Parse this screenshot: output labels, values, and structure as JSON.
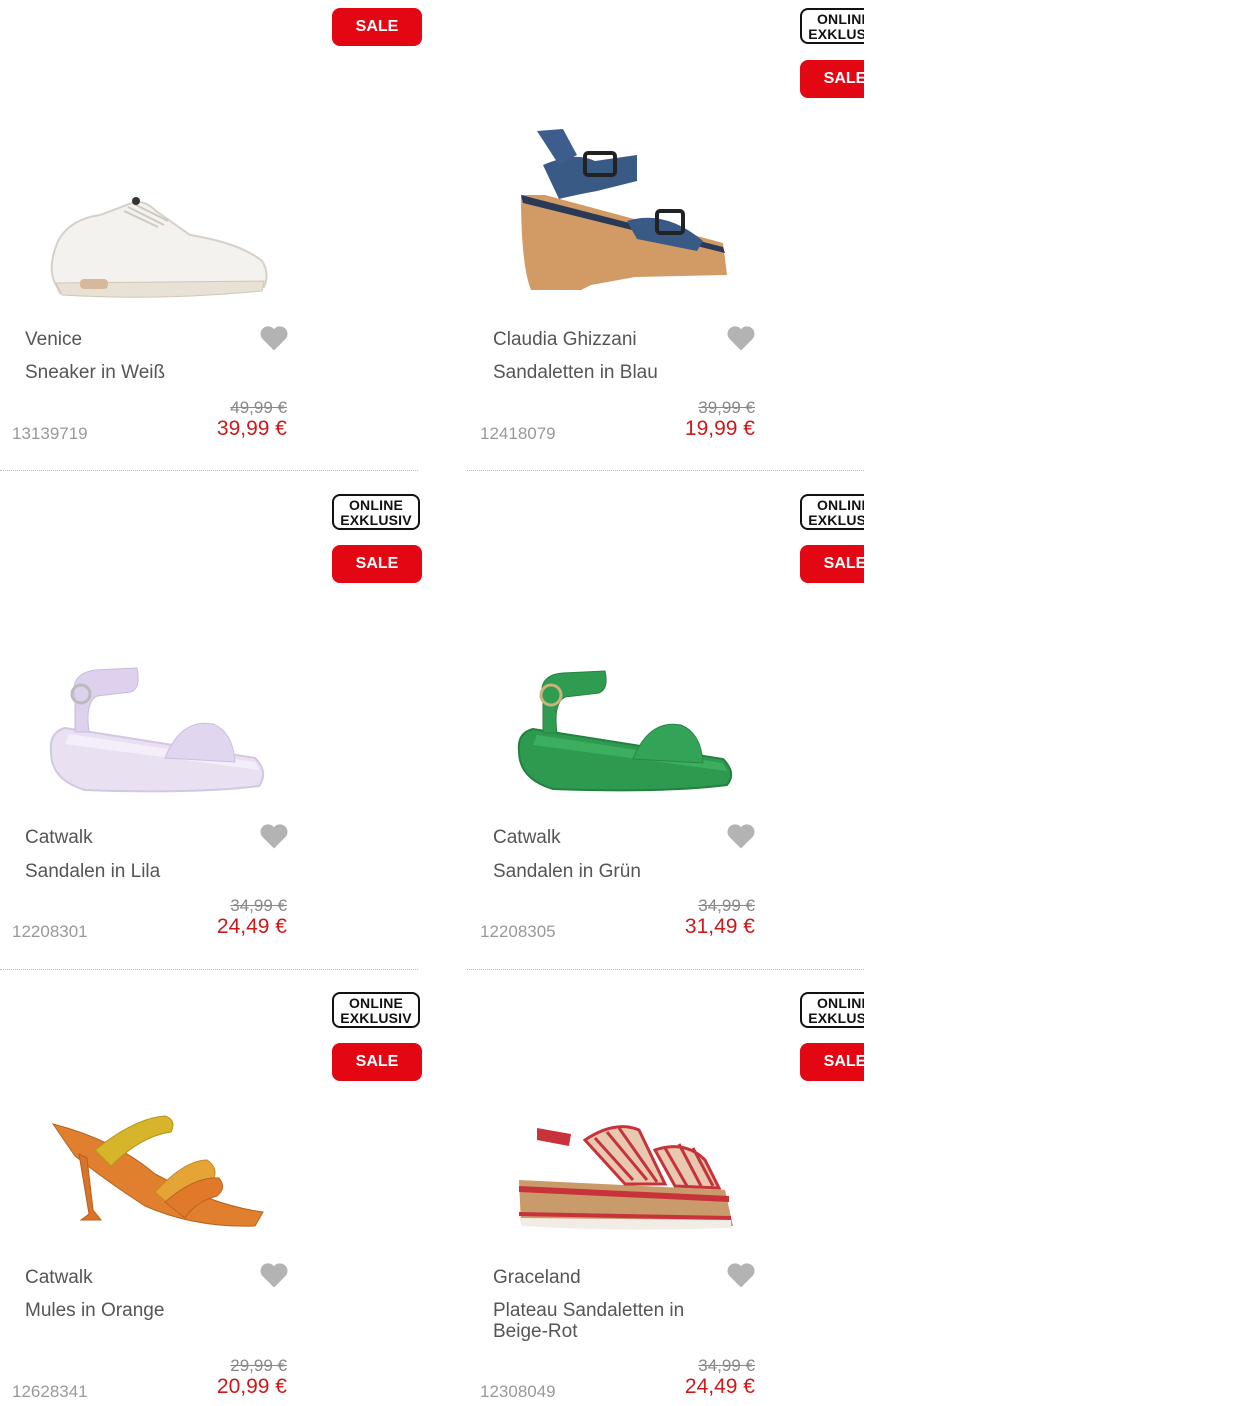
{
  "products": [
    {
      "brand": "Venice",
      "name": "Sneaker in Weiß",
      "sku": "13139719",
      "old_price": "49,99 €",
      "price": "39,99 €",
      "online_badge": "",
      "sale_badge": "SALE",
      "image": "white-sneaker"
    },
    {
      "brand": "Claudia Ghizzani",
      "name": "Sandaletten in Blau",
      "sku": "12418079",
      "old_price": "39,99 €",
      "price": "19,99 €",
      "online_badge": "ONLINE EXKLUSIV",
      "sale_badge": "SALE",
      "image": "blue-denim-platform-sandal"
    },
    {
      "brand": "Catwalk",
      "name": "Sandalen in Lila",
      "sku": "12208301",
      "old_price": "34,99 €",
      "price": "24,49 €",
      "online_badge": "ONLINE EXKLUSIV",
      "sale_badge": "SALE",
      "image": "lilac-sandal"
    },
    {
      "brand": "Catwalk",
      "name": "Sandalen in Grün",
      "sku": "12208305",
      "old_price": "34,99 €",
      "price": "31,49 €",
      "online_badge": "ONLINE EXKLUSIV",
      "sale_badge": "SALE",
      "image": "green-sandal"
    },
    {
      "brand": "Catwalk",
      "name": "Mules in Orange",
      "sku": "12628341",
      "old_price": "29,99 €",
      "price": "20,99 €",
      "online_badge": "ONLINE EXKLUSIV",
      "sale_badge": "SALE",
      "image": "orange-gold-mule"
    },
    {
      "brand": "Graceland",
      "name": "Plateau Sandaletten in Beige-Rot",
      "sku": "12308049",
      "old_price": "34,99 €",
      "price": "24,49 €",
      "online_badge": "ONLINE EXKLUSIV",
      "sale_badge": "SALE",
      "image": "striped-platform-sandal"
    }
  ],
  "icons": {
    "wishlist": "heart-icon"
  },
  "colors": {
    "sale": "#e30613",
    "price": "#cc1a1a",
    "text": "#555555",
    "sku": "#999999"
  }
}
